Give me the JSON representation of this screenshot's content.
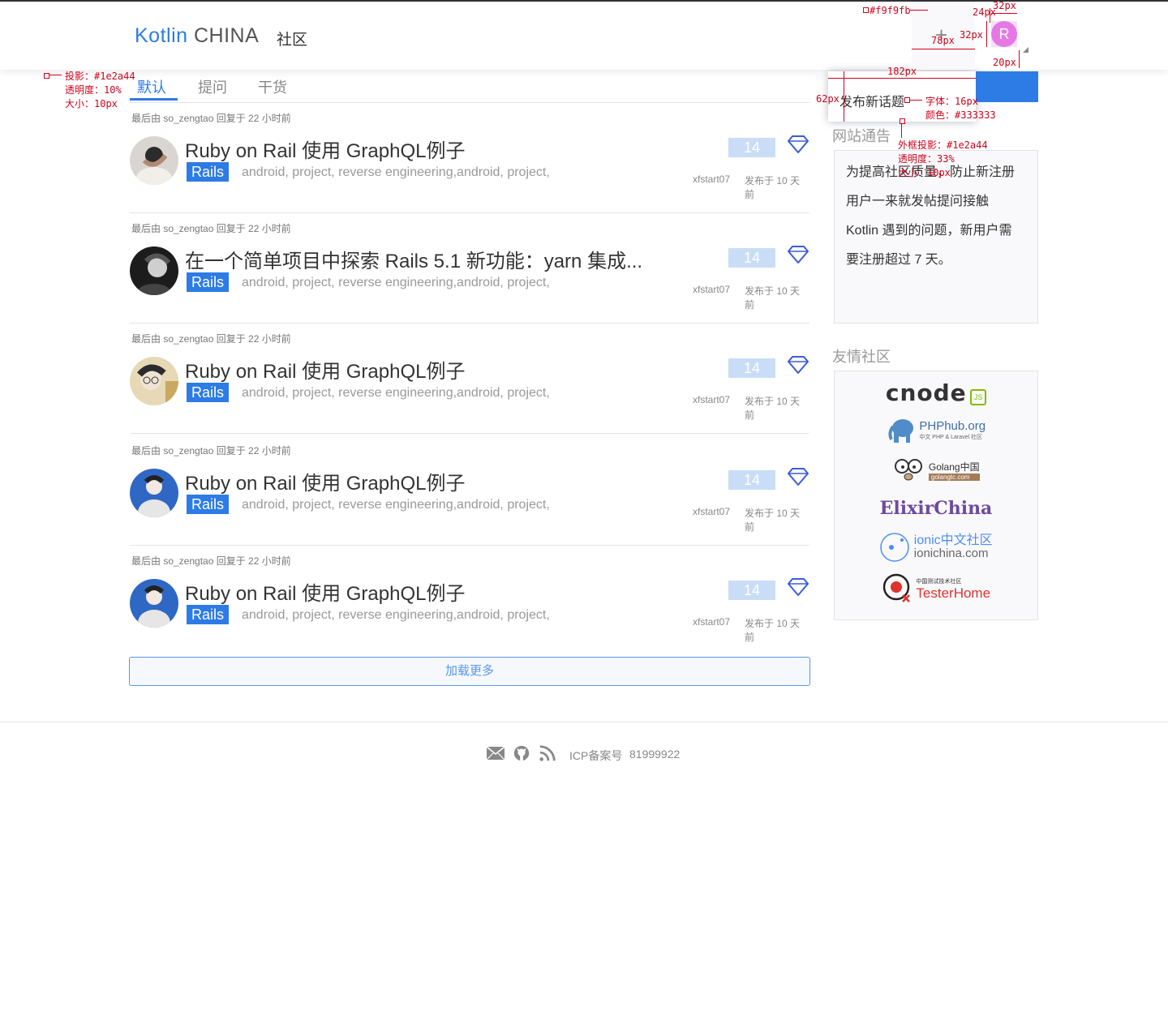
{
  "header": {
    "logo_kotlin": "Kotlin",
    "logo_china": "CHINA",
    "nav_community": "社区",
    "plus_icon": "plus-icon",
    "avatar_letter": "R",
    "avatar_color": "#e678e6"
  },
  "dropdown": {
    "new_topic": "发布新话题"
  },
  "tabs": [
    {
      "label": "默认",
      "active": true
    },
    {
      "label": "提问",
      "active": false
    },
    {
      "label": "干货",
      "active": false
    }
  ],
  "topics": [
    {
      "meta": "最后由 so_zengtao 回复于 22 小时前",
      "title": "Ruby on Rail 使用 GraphQL例子",
      "tag": "Rails",
      "tags": "android, project, reverse engineering,android, project,",
      "count": "14",
      "author": "xfstart07",
      "time": "发布于 10 天前"
    },
    {
      "meta": "最后由 so_zengtao 回复于 22 小时前",
      "title": "在一个简单项目中探索 Rails 5.1 新功能：yarn 集成...",
      "tag": "Rails",
      "tags": "android, project, reverse engineering,android, project,",
      "count": "14",
      "author": "xfstart07",
      "time": "发布于 10 天前"
    },
    {
      "meta": "最后由 so_zengtao 回复于 22 小时前",
      "title": "Ruby on Rail 使用 GraphQL例子",
      "tag": "Rails",
      "tags": "android, project, reverse engineering,android, project,",
      "count": "14",
      "author": "xfstart07",
      "time": "发布于 10 天前"
    },
    {
      "meta": "最后由 so_zengtao 回复于 22 小时前",
      "title": "Ruby on Rail 使用 GraphQL例子",
      "tag": "Rails",
      "tags": "android, project, reverse engineering,android, project,",
      "count": "14",
      "author": "xfstart07",
      "time": "发布于 10 天前"
    },
    {
      "meta": "最后由 so_zengtao 回复于 22 小时前",
      "title": "Ruby on Rail 使用 GraphQL例子",
      "tag": "Rails",
      "tags": "android, project, reverse engineering,android, project,",
      "count": "14",
      "author": "xfstart07",
      "time": "发布于 10 天前"
    }
  ],
  "load_more": "加载更多",
  "sidebar": {
    "notice_title": "网站通告",
    "notice_lines": [
      "为提高社区质量，防止新注册",
      "用户一来就发帖提问接触",
      "Kotlin 遇到的问题，新用户需",
      "要注册超过 7 天。"
    ],
    "friends_title": "友情社区",
    "friends": [
      "cnode",
      "PHPhub.org",
      "中文 PHP & Laravel 社区",
      "Golang中国",
      "golangtc.com",
      "ElixirChina",
      "ionic中文社区",
      "ionichina.com",
      "中国测试技术社区",
      "TesterHome"
    ]
  },
  "footer": {
    "icp_label": "ICP备案号",
    "icp_number": "81999922"
  },
  "annotations": {
    "bg_color": "#f9f9fb",
    "w_78": "78px",
    "h_32": "32px",
    "w_32": "32px",
    "gap_24": "24px",
    "gap_20": "20px",
    "shadow_1": "投影：#1e2a44",
    "opacity_1": "透明度：10%",
    "size_1": "大小：10px",
    "w_182": "182px",
    "h_62": "62px",
    "font_label": "字体：16px",
    "color_label": "颜色：#333333",
    "shadow_2": "外框投影：#1e2a44",
    "opacity_2": "透明度：33%",
    "size_2": "大小：10px"
  },
  "colors": {
    "accent": "#2d7be5",
    "text": "#333333",
    "muted": "#999999",
    "count_bg": "#c9ddf7"
  }
}
